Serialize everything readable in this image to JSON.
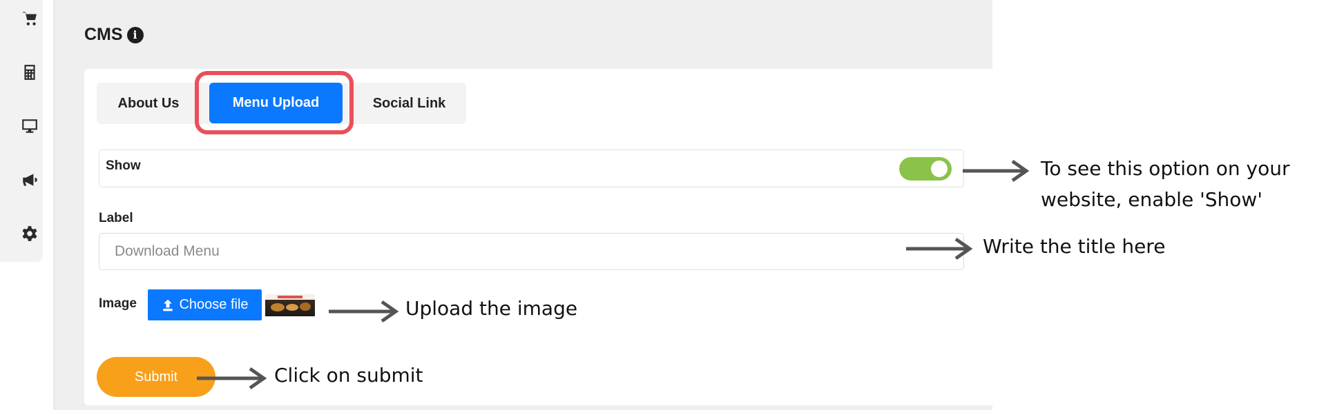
{
  "page": {
    "title": "CMS"
  },
  "sidebar": {
    "icons": [
      "cart-icon",
      "calculator-icon",
      "monitor-icon",
      "megaphone-icon",
      "gear-icon"
    ]
  },
  "tabs": [
    {
      "label": "About Us",
      "active": false
    },
    {
      "label": "Menu Upload",
      "active": true
    },
    {
      "label": "Social Link",
      "active": false
    }
  ],
  "form": {
    "show_label": "Show",
    "show_enabled": true,
    "label_field_label": "Label",
    "label_placeholder": "Download Menu",
    "image_label": "Image",
    "choose_file_label": "Choose file",
    "submit_label": "Submit"
  },
  "annotations": {
    "show_line1": "To see this option on your",
    "show_line2": "website, enable 'Show'",
    "title": "Write the title here",
    "image": "Upload the image",
    "submit": "Click on submit"
  },
  "colors": {
    "primary": "#0a78ff",
    "toggle_on": "#8bc34a",
    "submit": "#f8a01a",
    "highlight": "#e9505c"
  }
}
